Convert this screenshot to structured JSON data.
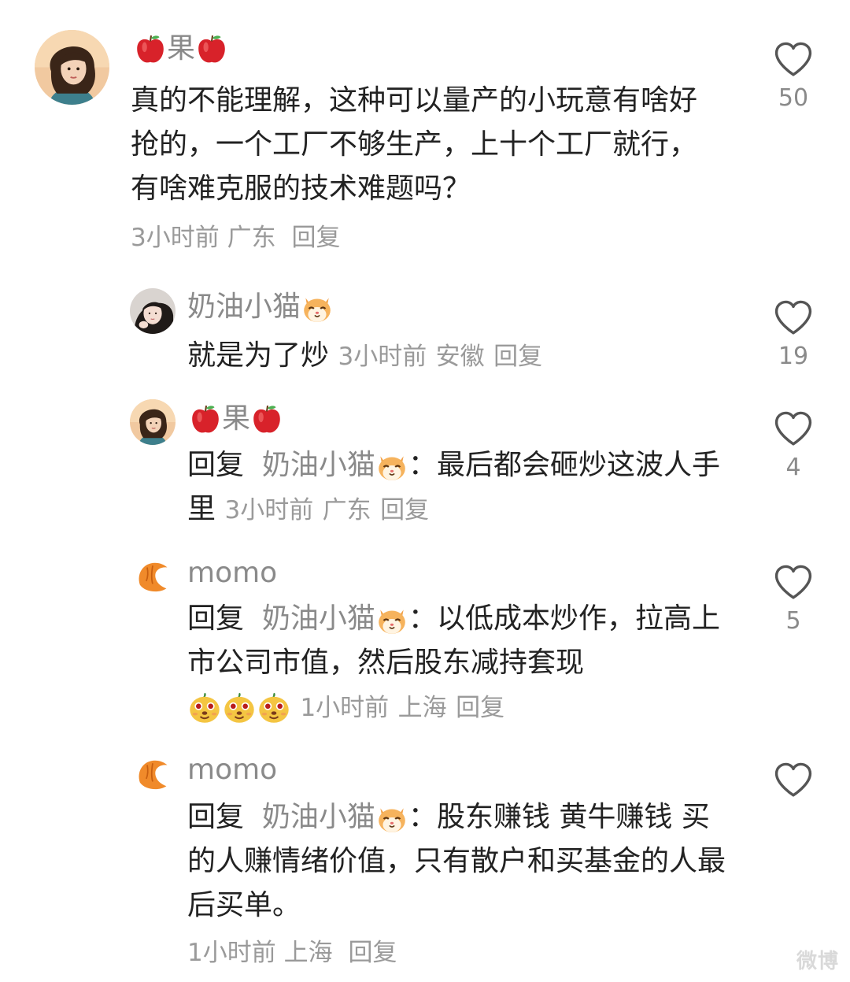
{
  "comments": [
    {
      "name_core": "果",
      "text": "真的不能理解，这种可以量产的小玩意有啥好抢的，一个工厂不够生产，上十个工厂就行，有啥难克服的技术难题吗？",
      "time": "3小时前",
      "location": "广东",
      "reply_label": "回复",
      "likes": "50"
    },
    {
      "name": "奶油小猫",
      "text": "就是为了炒",
      "time": "3小时前",
      "location": "安徽",
      "reply_label": "回复",
      "likes": "19"
    },
    {
      "name_core": "果",
      "reply_prefix": "回复",
      "mention": "奶油小猫",
      "colon": "：",
      "text": "最后都会砸炒这波人手里",
      "time": "3小时前",
      "location": "广东",
      "reply_label": "回复",
      "likes": "4"
    },
    {
      "name": "momo",
      "reply_prefix": "回复",
      "mention": "奶油小猫",
      "colon": "：",
      "text": "以低成本炒作，拉高上市公司市值，然后股东减持套现",
      "time": "1小时前",
      "location": "上海",
      "reply_label": "回复",
      "likes": "5"
    },
    {
      "name": "momo",
      "reply_prefix": "回复",
      "mention": "奶油小猫",
      "colon": "：",
      "text": "股东赚钱 黄牛赚钱 买的人赚情绪价值，只有散户和买基金的人最后买单。",
      "time": "1小时前",
      "location": "上海",
      "reply_label": "回复",
      "likes": ""
    }
  ],
  "icons": {
    "like": "heart-outline-icon",
    "apple": "red-apple-emoji",
    "cat": "hamster-cat-emoji",
    "doge": "yellow-doge-emoji",
    "croissant": "croissant-avatar"
  },
  "colors": {
    "name": "#8a8a8a",
    "text": "#222222",
    "meta": "#9a9a9a"
  },
  "watermark": "微博"
}
